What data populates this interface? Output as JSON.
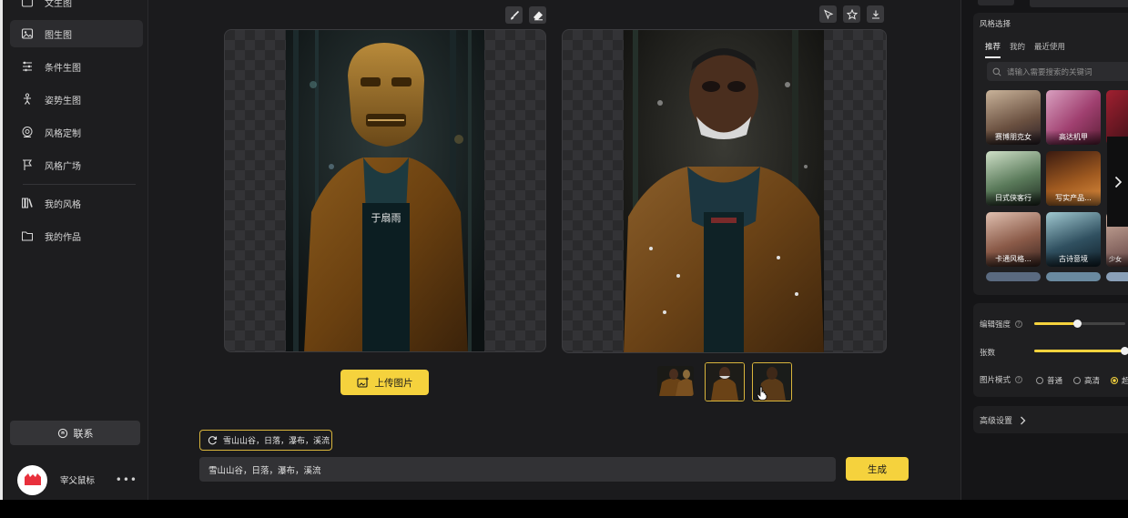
{
  "sidebar": {
    "top_item": "文生图",
    "items": [
      {
        "label": "图生图",
        "icon": "image-icon"
      },
      {
        "label": "条件生图",
        "icon": "sliders-icon"
      },
      {
        "label": "姿势生图",
        "icon": "pose-icon"
      },
      {
        "label": "风格定制",
        "icon": "target-icon"
      },
      {
        "label": "风格广场",
        "icon": "flag-icon"
      },
      {
        "label": "我的风格",
        "icon": "books-icon"
      },
      {
        "label": "我的作品",
        "icon": "folder-icon"
      }
    ],
    "contact_label": "联系",
    "user_name": "宰父鼠标"
  },
  "main": {
    "upload_label": "上传图片",
    "prompt_chip": "雪山山谷，日落，瀑布，溪流",
    "prompt_value": "雪山山谷，日落，瀑布，溪流",
    "generate_label": "生成"
  },
  "right": {
    "style_title": "风格选择",
    "tabs": [
      "推荐",
      "我的",
      "最近使用"
    ],
    "search_placeholder": "请输入需要搜索的关键词",
    "styles": [
      "赛博朋克女",
      "高达机甲",
      "日式侠客行",
      "写实产品...",
      "卡通风格...",
      "古诗意境",
      "少女"
    ],
    "strength_label": "编辑强度",
    "count_label": "张数",
    "mode_label": "图片模式",
    "modes": [
      "普通",
      "高清",
      "超"
    ],
    "strength_value": 0.48,
    "count_value": 1.0,
    "advanced_label": "高级设置"
  },
  "colors": {
    "accent": "#f5d23d",
    "bg": "#1b1b1d"
  }
}
